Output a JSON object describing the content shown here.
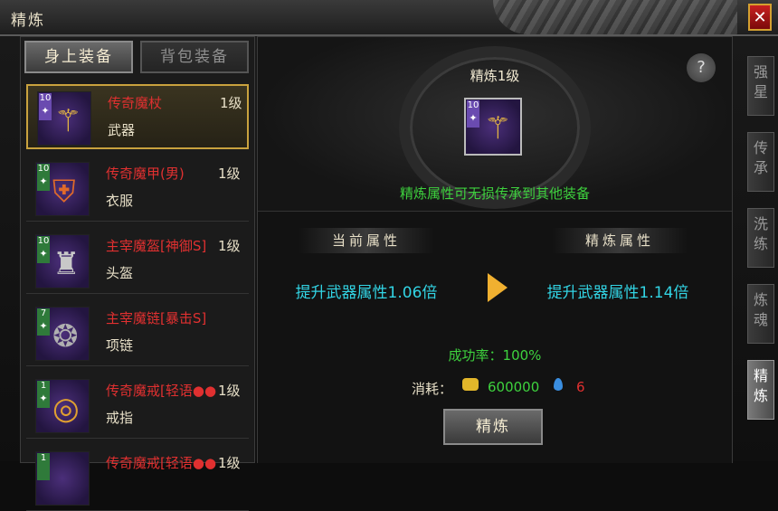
{
  "window": {
    "title": "精炼",
    "close_label": "✕"
  },
  "left_tabs": [
    "身上装备",
    "背包装备"
  ],
  "equipment": [
    {
      "level_badge": "10",
      "name": "传奇魔杖",
      "level": "1级",
      "type": "武器",
      "icon": "wand-icon",
      "selected": true
    },
    {
      "level_badge": "10",
      "name": "传奇魔甲(男)",
      "level": "1级",
      "type": "衣服",
      "icon": "armor-icon",
      "selected": false
    },
    {
      "level_badge": "10",
      "name": "主宰魔盔[神御S]",
      "level": "1级",
      "type": "头盔",
      "icon": "helmet-icon",
      "selected": false
    },
    {
      "level_badge": "7",
      "name": "主宰魔链[暴击S]",
      "level": "",
      "type": "项链",
      "icon": "necklace-icon",
      "selected": false
    },
    {
      "level_badge": "1",
      "name": "传奇魔戒[轻语●●",
      "level": "1级",
      "type": "戒指",
      "icon": "ring-icon",
      "selected": false
    },
    {
      "level_badge": "1",
      "name": "传奇魔戒[轻语●●",
      "level": "1级",
      "type": "",
      "icon": "ring-icon",
      "selected": false
    }
  ],
  "refine": {
    "title": "精炼1级",
    "hint": "精炼属性可无损传承到其他装备",
    "help": "?",
    "current_header": "当前属性",
    "refined_header": "精炼属性",
    "current_attr": "提升武器属性1.06倍",
    "refined_attr": "提升武器属性1.14倍",
    "success_rate": "成功率：100%",
    "cost_label": "消耗：",
    "gold_cost": "600000",
    "gem_cost": "6",
    "button": "精炼"
  },
  "side_tabs": [
    "强星",
    "传承",
    "洗练",
    "炼魂",
    "精炼"
  ],
  "colors": {
    "accent_gold": "#c9a23e",
    "item_red": "#e03030",
    "attr_cyan": "#32d4e4",
    "success_green": "#3ed23e"
  }
}
